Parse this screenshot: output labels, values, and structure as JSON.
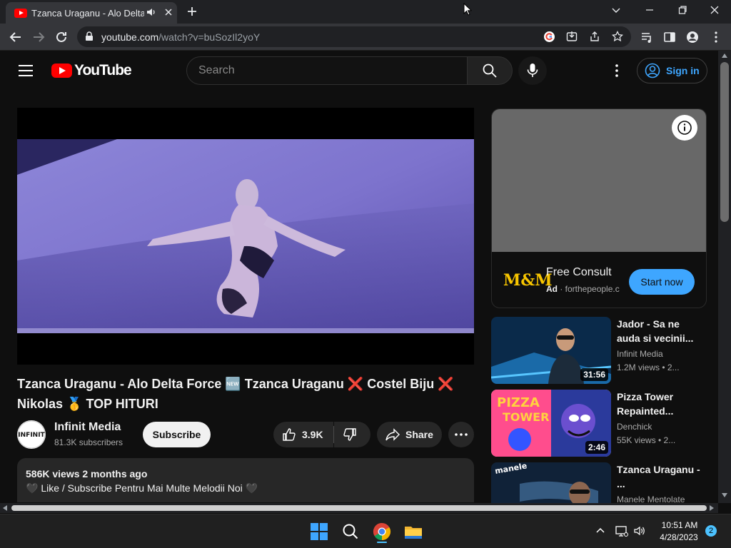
{
  "browser": {
    "tab_title": "Tzanca Uraganu - Alo Delta Force",
    "url_host": "youtube.com",
    "url_path": "/watch?v=buSozIl2yoY"
  },
  "header": {
    "logo_text": "YouTube",
    "search_placeholder": "Search",
    "signin_label": "Sign in"
  },
  "video": {
    "title": "Tzanca Uraganu - Alo Delta Force 🆕 Tzanca Uraganu ❌ Costel Biju ❌ Nikolas 🥇 TOP HITURI",
    "channel": "Infinit Media",
    "subscribers": "81.3K subscribers",
    "subscribe_label": "Subscribe",
    "likes": "3.9K",
    "share_label": "Share",
    "views_age": "586K views  2 months ago",
    "description_line": "🖤 Like / Subscribe Pentru Mai Multe Melodii Noi 🖤"
  },
  "ad": {
    "logo": "M&M",
    "title": "Free Consult",
    "label": "Ad",
    "domain": "forthepeople.c",
    "cta": "Start now"
  },
  "recommendations": [
    {
      "title": "Jador - Sa ne auda si vecinii...",
      "channel": "Infinit Media",
      "meta": "1.2M views  • 2...",
      "duration": "31:56"
    },
    {
      "title": "Pizza Tower Repainted...",
      "channel": "Denchick",
      "meta": "55K views  • 2...",
      "duration": "2:46"
    },
    {
      "title": "Tzanca Uraganu - ...",
      "channel": "Manele Mentolate",
      "meta": "",
      "duration": ""
    }
  ],
  "taskbar": {
    "time": "10:51 AM",
    "date": "4/28/2023",
    "notifications": "2"
  }
}
